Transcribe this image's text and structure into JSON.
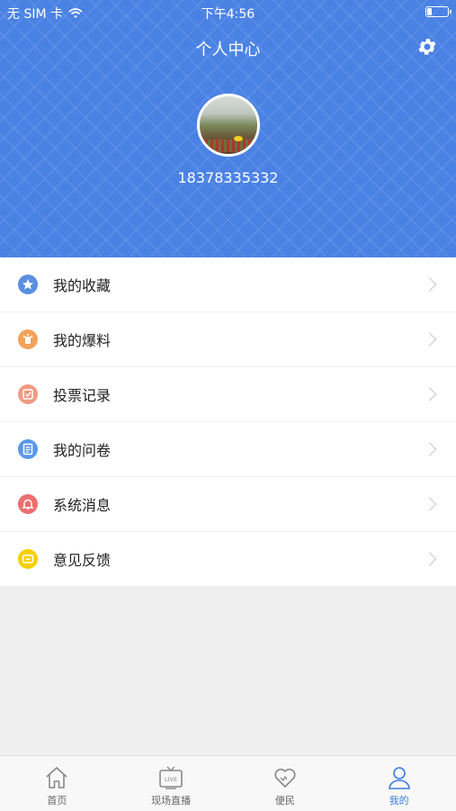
{
  "status_bar": {
    "carrier": "无 SIM 卡",
    "time": "下午4:56"
  },
  "header": {
    "title": "个人中心",
    "phone": "18378335332"
  },
  "menu": [
    {
      "label": "我的收藏",
      "icon": "star-icon",
      "color": "#5a8fe0"
    },
    {
      "label": "我的爆料",
      "icon": "broadcast-icon",
      "color": "#f3a35b"
    },
    {
      "label": "投票记录",
      "icon": "vote-icon",
      "color": "#f19a84"
    },
    {
      "label": "我的问卷",
      "icon": "questionnaire-icon",
      "color": "#5a97e8"
    },
    {
      "label": "系统消息",
      "icon": "bell-icon",
      "color": "#ee6e6e"
    },
    {
      "label": "意见反馈",
      "icon": "feedback-icon",
      "color": "#f5d000"
    }
  ],
  "tabbar": [
    {
      "label": "首页",
      "icon": "home-icon"
    },
    {
      "label": "现场直播",
      "icon": "live-tv-icon",
      "badge": "LIVE"
    },
    {
      "label": "便民",
      "icon": "heart-icon"
    },
    {
      "label": "我的",
      "icon": "person-icon",
      "active": true
    }
  ],
  "colors": {
    "header_bg": "#4a82e4",
    "active_tab": "#3b7de0"
  }
}
